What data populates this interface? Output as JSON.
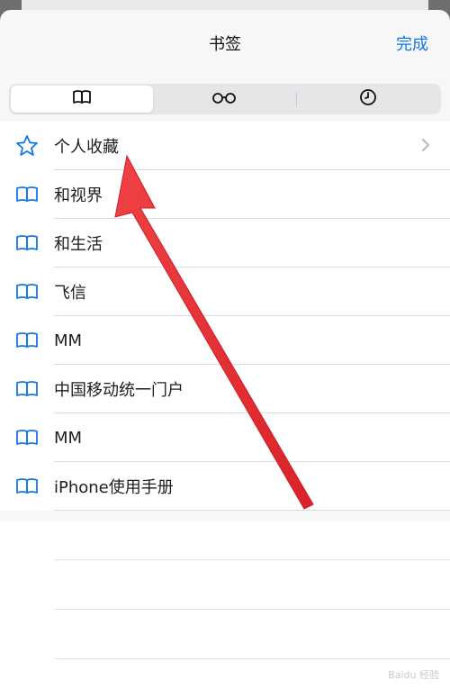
{
  "header": {
    "title": "书签",
    "done_label": "完成"
  },
  "segments": [
    {
      "icon": "book-icon",
      "active": true
    },
    {
      "icon": "reading-list-icon",
      "active": false
    },
    {
      "icon": "history-icon",
      "active": false
    }
  ],
  "bookmarks": [
    {
      "label": "个人收藏",
      "icon": "star-icon",
      "has_chevron": true
    },
    {
      "label": "和视界",
      "icon": "book-icon",
      "has_chevron": false
    },
    {
      "label": "和生活",
      "icon": "book-icon",
      "has_chevron": false
    },
    {
      "label": "飞信",
      "icon": "book-icon",
      "has_chevron": false
    },
    {
      "label": "MM",
      "icon": "book-icon",
      "has_chevron": false
    },
    {
      "label": "中国移动统一门户",
      "icon": "book-icon",
      "has_chevron": false
    },
    {
      "label": "MM",
      "icon": "book-icon",
      "has_chevron": false
    },
    {
      "label": "iPhone使用手册",
      "icon": "book-icon",
      "has_chevron": false
    }
  ],
  "colors": {
    "accent": "#1677e5",
    "annotation_arrow": "#e32b30"
  }
}
